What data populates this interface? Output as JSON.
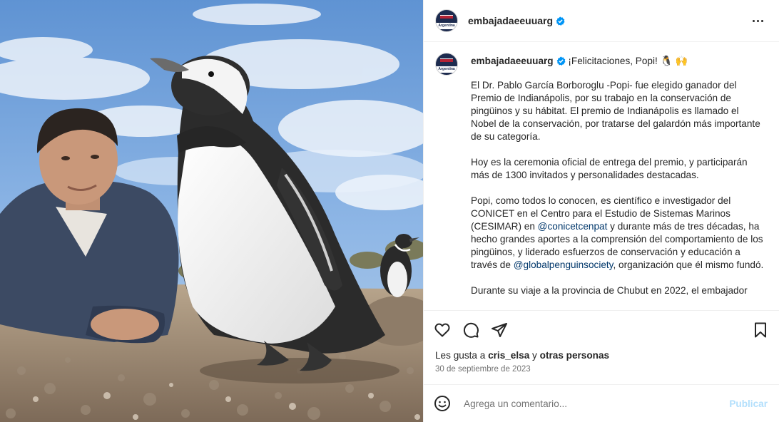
{
  "post": {
    "username": "embajadaeeuuarg",
    "avatar_label": "Argentina",
    "verified": true,
    "more_icon": "more-horizontal-icon",
    "caption": {
      "headline": "¡Felicitaciones, Popi!",
      "headline_emojis": "🐧 🙌",
      "paragraphs": [
        "El Dr. Pablo García Borboroglu -Popi- fue elegido ganador del Premio de Indianápolis, por su trabajo en la conservación de pingüinos y su hábitat. El premio de Indianápolis es llamado el Nobel de la conservación, por tratarse del galardón más importante de su categoría.",
        "Hoy es la ceremonia oficial de entrega del premio, y participarán más de 1300 invitados y personalidades destacadas."
      ],
      "p3_part1": "Popi, como todos lo conocen, es científico e investigador del CONICET en el Centro para el Estudio de Sistemas Marinos (CESIMAR) en ",
      "p3_mention1": "@conicetcenpat",
      "p3_part2": " y durante más de tres décadas, ha hecho grandes aportes a la comprensión del comportamiento de los pingüinos, y liderado esfuerzos de conservación y educación a través de ",
      "p3_mention2": "@globalpenguinsociety",
      "p3_part3": ", organización que él mismo fundó.",
      "p4": "Durante su viaje a la provincia de Chubut en 2022, el embajador"
    },
    "likes_prefix": "Les gusta a ",
    "likes_user": "cris_elsa",
    "likes_mid": " y ",
    "likes_others": "otras personas",
    "date": "30 de septiembre de 2023",
    "comment_placeholder": "Agrega un comentario...",
    "publish_label": "Publicar",
    "colors": {
      "verified": "#0095f6",
      "link": "#00376b",
      "publish": "#b2dffc",
      "secondary": "#737373"
    },
    "icons": [
      "heart-icon",
      "comment-icon",
      "share-icon",
      "bookmark-icon",
      "emoji-icon"
    ]
  }
}
